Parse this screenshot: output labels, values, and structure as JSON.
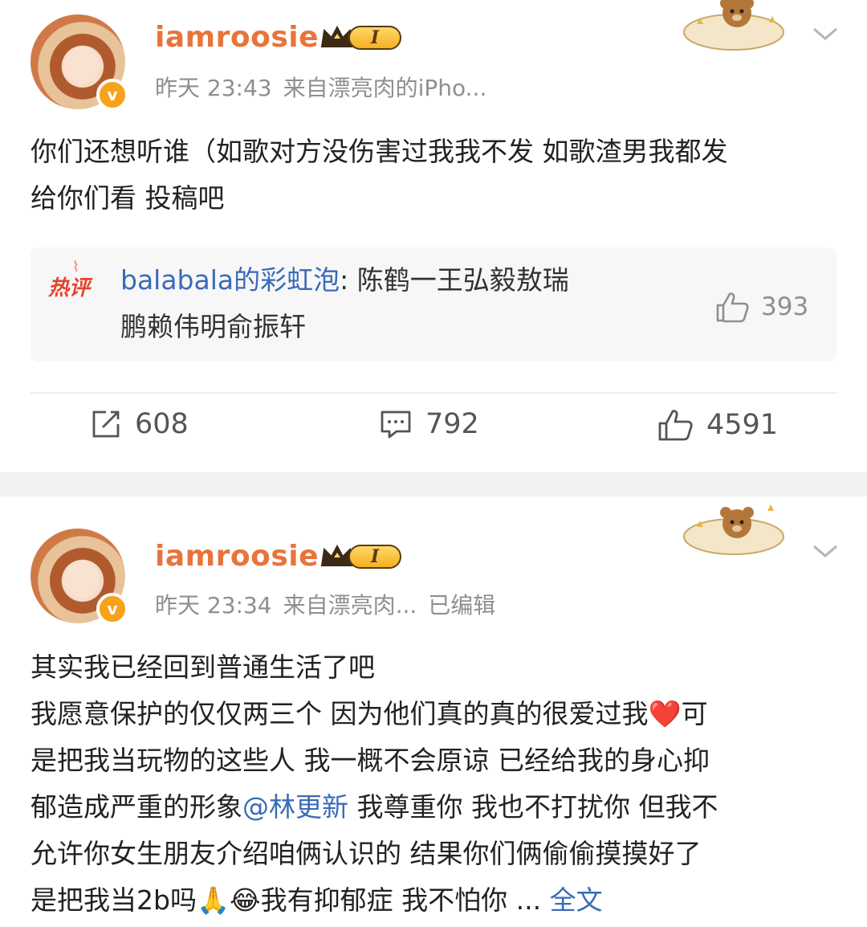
{
  "posts": [
    {
      "username": "iamroosie",
      "level": "I",
      "verified_mark": "v",
      "time": "昨天 23:43",
      "source": "来自漂亮肉的iPho...",
      "content_lines": [
        "你们还想听谁（如歌对方没伤害过我我不发 如歌渣男我都发",
        "给你们看 投稿吧"
      ],
      "hot_comment": {
        "tag": "热评",
        "commenter": "balabala的彩虹泡",
        "colon": ":",
        "text_line1": " 陈鹤一王弘毅敖瑞",
        "text_line2": "鹏赖伟明俞振轩",
        "likes": "393"
      },
      "actions": {
        "reposts": "608",
        "comments": "792",
        "likes": "4591"
      }
    },
    {
      "username": "iamroosie",
      "level": "I",
      "verified_mark": "v",
      "time": "昨天 23:34",
      "source": "来自漂亮肉...",
      "edited": "已编辑",
      "content": {
        "line1": "其实我已经回到普通生活了吧",
        "line2_a": "我愿意保护的仅仅两三个 因为他们真的真的很爱过我",
        "line2_emoji": "❤️",
        "line2_b": "可",
        "line3": "是把我当玩物的这些人 我一概不会原谅 已经给我的身心抑",
        "line4_a": "郁造成严重的形象",
        "mention": "@林更新",
        "line4_b": " 我尊重你 我也不打扰你 但我不",
        "line5": "允许你女生朋友介绍咱俩认识的 结果你们俩偷偷摸摸好了",
        "line6_a": "是把我当2b吗",
        "line6_emoji1": "🙏",
        "line6_emoji2": "😂",
        "line6_b": "我有抑郁症 我不怕你 ...",
        "full_text_link": "全文"
      }
    }
  ],
  "icons": {
    "repost": "repost-icon",
    "comment": "comment-icon",
    "like": "thumbs-up-icon",
    "menu": "chevron-down-icon",
    "crown": "crown-icon"
  },
  "colors": {
    "username": "#e8743b",
    "link": "#3a6bb7",
    "meta": "#8f8f8f",
    "hot_tag": "#e8432f",
    "verified": "#f7a21b"
  }
}
